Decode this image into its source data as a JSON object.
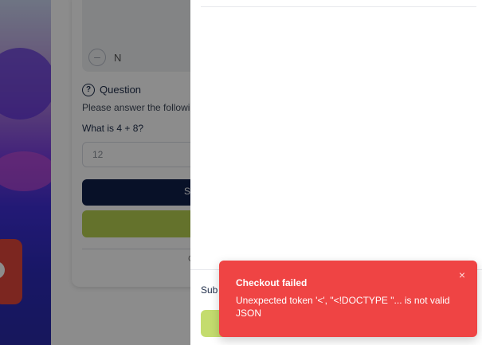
{
  "background": {
    "question": {
      "heading": "Question",
      "instruction": "Please answer the followi",
      "prompt": "What is 4 + 8?",
      "answer_value": "12"
    },
    "image_caption_letter": "N",
    "dark_button_partial": "S",
    "footer_partial": "C"
  },
  "drawer": {
    "footer_label_partial": "Sub"
  },
  "toast": {
    "title": "Checkout failed",
    "message": "Unexpected token '<', \"<!DOCTYPE \"... is not valid JSON",
    "close_icon": "×"
  },
  "colors": {
    "toast_bg": "#ef4444",
    "primary_dark": "#0f1f4a",
    "accent_olive": "#b7cf50"
  }
}
